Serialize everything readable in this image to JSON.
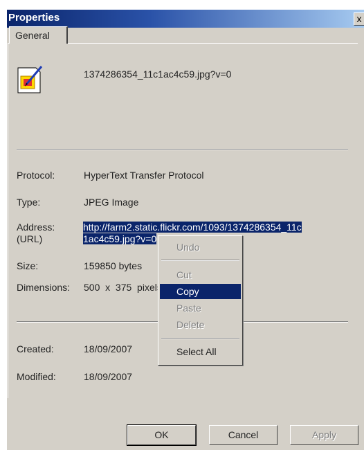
{
  "window": {
    "title": "Properties",
    "close_glyph": "x"
  },
  "tabs": [
    {
      "label": "General"
    }
  ],
  "file": {
    "name": "1374286354_11c1ac4c59.jpg?v=0",
    "icon": "jpeg-file-icon"
  },
  "fields": {
    "protocol": {
      "label": "Protocol:",
      "value": "HyperText Transfer Protocol"
    },
    "type": {
      "label": "Type:",
      "value": "JPEG Image"
    },
    "address": {
      "label_line1": "Address:",
      "label_line2": "(URL)",
      "url_line1": "http://farm2.static.flickr.com/1093/1374286354_11c",
      "url_line2": "1ac4c59.jpg?v=0"
    },
    "size": {
      "label": "Size:",
      "value": "159850 bytes"
    },
    "dimensions": {
      "label": "Dimensions:",
      "value": "500  x  375  pixels"
    },
    "created": {
      "label": "Created:",
      "value": "18/09/2007"
    },
    "modified": {
      "label": "Modified:",
      "value": "18/09/2007"
    }
  },
  "context_menu": {
    "undo": "Undo",
    "cut": "Cut",
    "copy": "Copy",
    "paste": "Paste",
    "delete": "Delete",
    "select_all": "Select All"
  },
  "buttons": {
    "ok": "OK",
    "cancel": "Cancel",
    "apply": "Apply"
  },
  "colors": {
    "highlight": "#0a246a",
    "face": "#d4d0c8"
  }
}
